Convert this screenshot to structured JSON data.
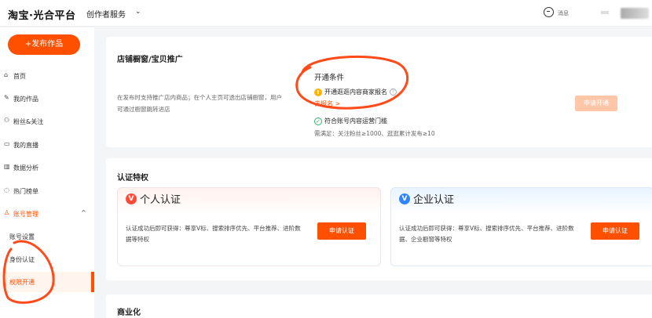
{
  "topbar": {
    "logo": "淘宝·光合平台",
    "service": "创作者服务",
    "message_label": "消息"
  },
  "sidebar": {
    "publish_label": "+发布作品",
    "items": [
      {
        "label": "首页",
        "icon": "home-icon"
      },
      {
        "label": "我的作品",
        "icon": "edit-icon"
      },
      {
        "label": "粉丝&关注",
        "icon": "fans-icon"
      },
      {
        "label": "我的直播",
        "icon": "live-icon"
      },
      {
        "label": "数据分析",
        "icon": "chart-icon"
      },
      {
        "label": "热门榜单",
        "icon": "hot-icon"
      },
      {
        "label": "账号管理",
        "icon": "user-icon"
      }
    ],
    "sub_items": [
      {
        "label": "账号设置"
      },
      {
        "label": "身份认证"
      },
      {
        "label": "权限开通"
      }
    ]
  },
  "store_promo": {
    "title": "店铺橱窗/宝贝推广",
    "description": "在发布时支持推广店内商品；在个人主页可透出店铺橱窗，用户可通过橱窗跳转进店",
    "condition_title": "开通条件",
    "condition1": "开通逛逛内容商家报名",
    "condition1_link": "去报名 >",
    "condition2": "符合账号内容运营门槛",
    "requirement": "需满足：关注粉丝≥1000、逛逛累计发布≥10",
    "apply_button": "申请开通"
  },
  "certification": {
    "title": "认证特权",
    "personal": {
      "name": "个人认证",
      "description": "认证成功后即可获得：尊享V标、搜索排序优先、平台推荐、进阶数据等特权",
      "button": "申请认证"
    },
    "enterprise": {
      "name": "企业认证",
      "description": "认证成功后即可获得：尊享V标、搜索排序优先、平台推荐、进阶数据、企业橱窗等特权",
      "button": "申请认证"
    }
  },
  "commerce": {
    "title": "商业化"
  },
  "colors": {
    "brand": "#ff5000",
    "annotation": "#ff4a1a"
  }
}
